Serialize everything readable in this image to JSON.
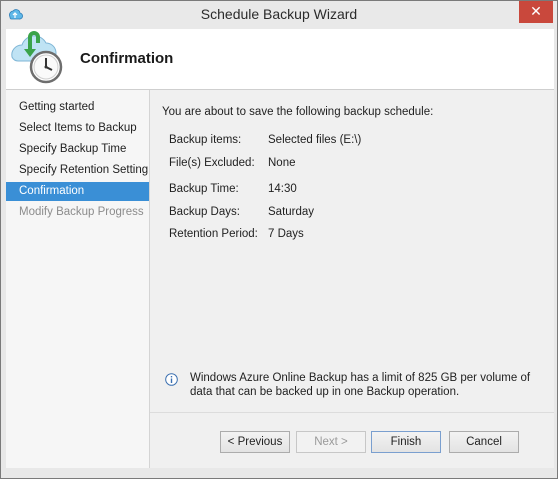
{
  "window": {
    "title": "Schedule Backup Wizard",
    "close_glyph": "✕",
    "app_icon": "backup-app-icon"
  },
  "header": {
    "title": "Confirmation",
    "icon": "backup-clock-icon"
  },
  "nav": {
    "items": [
      {
        "label": "Getting started",
        "state": "normal"
      },
      {
        "label": "Select Items to Backup",
        "state": "normal"
      },
      {
        "label": "Specify Backup Time",
        "state": "normal"
      },
      {
        "label": "Specify Retention Setting",
        "state": "normal"
      },
      {
        "label": "Confirmation",
        "state": "selected"
      },
      {
        "label": "Modify Backup Progress",
        "state": "disabled"
      }
    ]
  },
  "content": {
    "intro": "You are about to save the following backup schedule:",
    "summary": [
      {
        "label": "Backup items:",
        "value": "Selected files (E:\\)"
      },
      {
        "label": "File(s) Excluded:",
        "value": "None"
      },
      {
        "label": "Backup Time:",
        "value": "14:30"
      },
      {
        "label": "Backup Days:",
        "value": "Saturday"
      },
      {
        "label": "Retention Period:",
        "value": "7 Days"
      }
    ],
    "info_icon": "info-icon",
    "info_text": "Windows Azure Online Backup has a limit of 825 GB per volume of data that can be backed up in one Backup operation."
  },
  "buttons": {
    "previous": "< Previous",
    "next": "Next >",
    "finish": "Finish",
    "cancel": "Cancel"
  },
  "colors": {
    "selected_nav": "#3a8fd6",
    "close_button": "#c9483c",
    "accent_green": "#3aa34a"
  }
}
